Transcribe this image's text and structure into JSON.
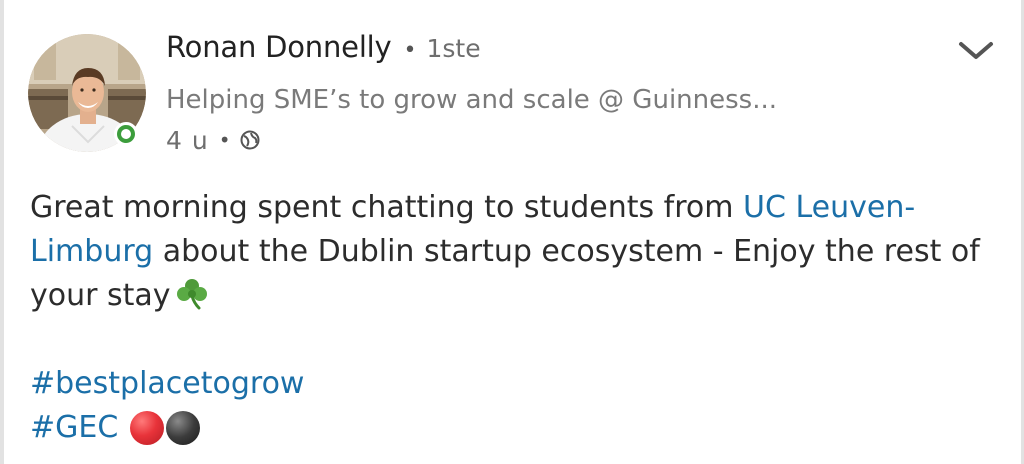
{
  "post": {
    "author": {
      "name": "Ronan Donnelly",
      "degree": "1ste",
      "headline": "Helping SME’s to grow and scale @ Guinness...",
      "online": true
    },
    "timestamp": "4 u",
    "separator": "•",
    "visibility_icon": "globe-icon",
    "menu_icon": "chevron-down-icon",
    "body": {
      "segments": [
        {
          "text": "Great morning spent chatting to students from ",
          "link": false
        },
        {
          "text": "UC Leuven-Limburg",
          "link": true
        },
        {
          "text": " about the Dublin startup ecosystem - Enjoy the rest of your stay",
          "link": false
        }
      ],
      "emoji": "shamrock"
    },
    "hashtags": [
      {
        "text": "#bestplacetogrow"
      },
      {
        "text": "#GEC",
        "emojis": [
          "red-circle",
          "black-circle"
        ]
      }
    ]
  },
  "colors": {
    "link": "#1b6fa8",
    "online": "#3c9d3c",
    "text": "#2c2c2c",
    "meta": "#7a7a7a"
  }
}
